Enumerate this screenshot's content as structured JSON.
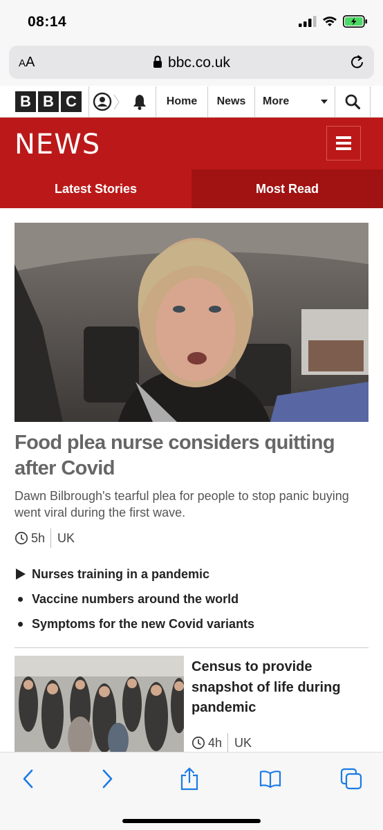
{
  "status_bar": {
    "time": "08:14"
  },
  "browser": {
    "text_size_label": "AA",
    "url": "bbc.co.uk"
  },
  "bbc_nav": {
    "logo_letters": [
      "B",
      "B",
      "C"
    ],
    "home": "Home",
    "news": "News",
    "more": "More"
  },
  "header": {
    "wordmark": "NEWS"
  },
  "tabs": [
    {
      "label": "Latest Stories",
      "active": false
    },
    {
      "label": "Most Read",
      "active": true
    }
  ],
  "lead_story": {
    "headline": "Food plea nurse considers quitting after Covid",
    "summary": "Dawn Bilbrough's tearful plea for people to stop panic buying went viral during the first wave.",
    "time": "5h",
    "section": "UK",
    "related": [
      {
        "label": "Nurses training in a pandemic",
        "type": "video"
      },
      {
        "label": "Vaccine numbers around the world",
        "type": "link"
      },
      {
        "label": "Symptoms for the new Covid variants",
        "type": "link"
      }
    ]
  },
  "second_story": {
    "headline": "Census to provide snapshot of life during pandemic",
    "time": "4h",
    "section": "UK"
  },
  "colors": {
    "bbc_red": "#bb1919",
    "tab_active": "#a11212",
    "ios_blue": "#1a7ae6"
  },
  "toolbar_icons": [
    "back-icon",
    "forward-icon",
    "share-icon",
    "bookmarks-icon",
    "tabs-icon"
  ]
}
